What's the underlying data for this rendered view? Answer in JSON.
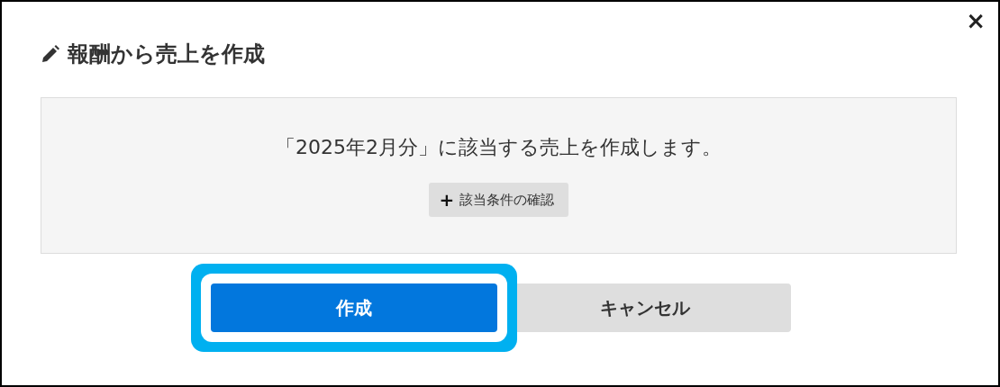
{
  "dialog": {
    "title": "報酬から売上を作成",
    "close": "×",
    "message": "「2025年2月分」に該当する売上を作成します。",
    "details_button": {
      "icon": "+",
      "label": "該当条件の確認"
    },
    "buttons": [
      {
        "label": "作成",
        "kind": "primary",
        "highlighted": true
      },
      {
        "label": "キャンセル",
        "kind": "secondary",
        "highlighted": false
      }
    ]
  }
}
